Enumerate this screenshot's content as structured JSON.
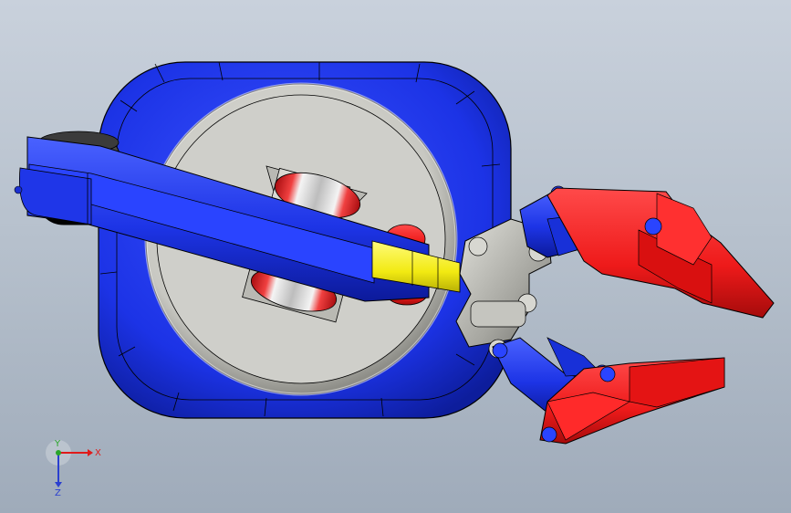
{
  "viewport": {
    "background_top": "#c9d1dc",
    "background_bottom": "#9fabba"
  },
  "model": {
    "colors": {
      "base_blue": "#1c33e6",
      "gripper_red": "#f01818",
      "platter_gray": "#c9c9c4",
      "connector_yellow": "#f4ee1c",
      "hub_gray": "#a9a9a4",
      "roller_black": "#1a1a1a"
    }
  },
  "triad": {
    "x_label": "X",
    "y_label": "Y",
    "z_label": "Z",
    "colors": {
      "x": "#e01a1a",
      "y": "#2aa52a",
      "z": "#2a3fd0"
    }
  }
}
